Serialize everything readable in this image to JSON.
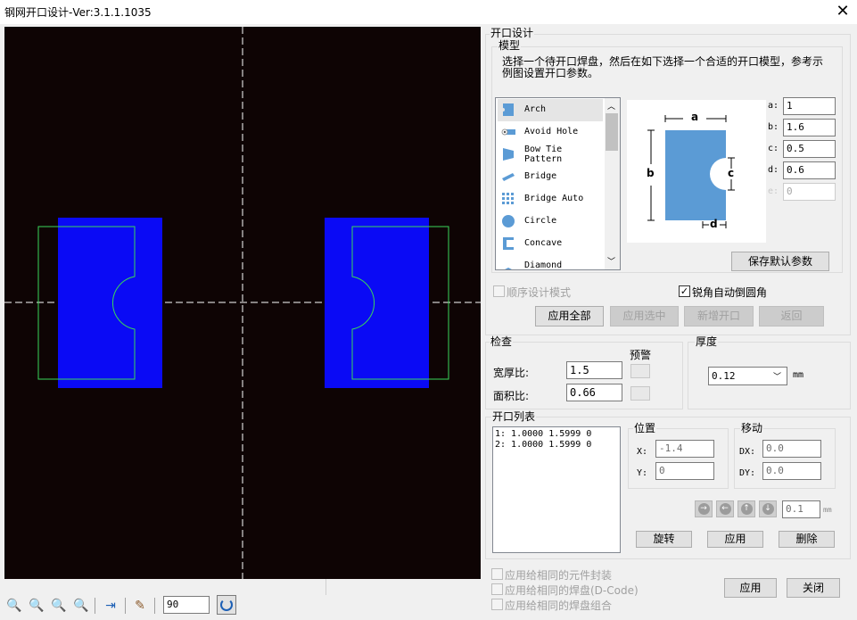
{
  "window": {
    "title": "钢网开口设计-Ver:3.1.1.1035",
    "close_glyph": "✕"
  },
  "design_panel": {
    "title": "开口设计",
    "model_group": {
      "title": "模型",
      "instruction_line1": "选择一个待开口焊盘，然后在如下选择一个合适的开口模型，参考示",
      "instruction_line2": "例图设置开口参数。",
      "models": [
        {
          "name": "Arch",
          "icon": "arch-icon",
          "selected": true
        },
        {
          "name": "Avoid Hole",
          "icon": "avoid-hole-icon"
        },
        {
          "name": "Bow Tie Pattern",
          "line1": "Bow Tie",
          "line2": "Pattern",
          "icon": "bow-tie-icon"
        },
        {
          "name": "Bridge",
          "icon": "bridge-icon"
        },
        {
          "name": "Bridge Auto",
          "icon": "bridge-auto-icon"
        },
        {
          "name": "Circle",
          "icon": "circle-icon"
        },
        {
          "name": "Concave",
          "icon": "concave-icon"
        },
        {
          "name": "Diamond",
          "icon": "diamond-icon"
        }
      ],
      "diagram_labels": {
        "a": "a",
        "b": "b",
        "c": "c",
        "d": "d"
      },
      "params": [
        {
          "label": "a:",
          "value": "1",
          "enabled": true
        },
        {
          "label": "b:",
          "value": "1.6",
          "enabled": true
        },
        {
          "label": "c:",
          "value": "0.5",
          "enabled": true
        },
        {
          "label": "d:",
          "value": "0.6",
          "enabled": true
        },
        {
          "label": "e:",
          "value": "0",
          "enabled": false
        }
      ],
      "save_default_label": "保存默认参数"
    },
    "sequential_mode_label": "顺序设计模式",
    "sequential_mode_checked": false,
    "auto_round_label": "锐角自动倒圆角",
    "auto_round_checked": true,
    "buttons": {
      "apply_all": "应用全部",
      "apply_selected": "应用选中",
      "add_opening": "新增开口",
      "back": "返回"
    }
  },
  "check": {
    "title": "检查",
    "warning_label": "预警",
    "aspect_ratio_label": "宽厚比:",
    "aspect_ratio_value": "1.5",
    "area_ratio_label": "面积比:",
    "area_ratio_value": "0.66"
  },
  "thickness": {
    "title": "厚度",
    "value": "0.12",
    "unit": "mm"
  },
  "opening_list": {
    "title": "开口列表",
    "items": [
      "1: 1.0000 1.5999 0",
      "2: 1.0000 1.5999 0"
    ],
    "position": {
      "title": "位置",
      "x_label": "X:",
      "x_value": "-1.4",
      "y_label": "Y:",
      "y_value": "0"
    },
    "move": {
      "title": "移动",
      "dx_label": "DX:",
      "dx_value": "0.0",
      "dy_label": "DY:",
      "dy_value": "0.0"
    },
    "step_value": "0.1",
    "step_unit": "mm",
    "arrows": [
      "→",
      "←",
      "↑",
      "↓"
    ],
    "buttons": {
      "rotate": "旋转",
      "apply": "应用",
      "delete": "删除"
    }
  },
  "apply_options": [
    "应用给相同的元件封装",
    "应用给相同的焊盘(D-Code)",
    "应用给相同的焊盘组合"
  ],
  "footer_buttons": {
    "apply": "应用",
    "close": "关闭"
  },
  "toolbar": {
    "icons": [
      "zoom-in-icon",
      "zoom-out-icon",
      "zoom-fit-icon",
      "zoom-window-icon",
      "measure-icon",
      "clear-icon",
      "rotate-icon"
    ],
    "angle_value": "90"
  },
  "colors": {
    "canvas_bg": "#0e0404",
    "pad_fill": "#0a0af5",
    "outline": "#39d65a",
    "model_icon": "#5b9bd5"
  }
}
